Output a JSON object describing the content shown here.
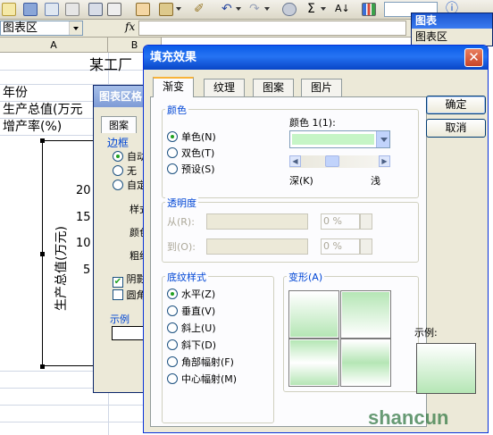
{
  "formula_bar": {
    "name_box": "图表区",
    "fx": "fx"
  },
  "columns": [
    "A",
    "B"
  ],
  "sheet": {
    "title_cell": "某工厂",
    "rows": [
      "年份",
      "生产总值(万元",
      "增产率(%)"
    ]
  },
  "chart": {
    "ylabel": "生产总值(万元)",
    "ticks": [
      "20",
      "15",
      "10",
      "5"
    ]
  },
  "chart_popup": {
    "title": "图表",
    "item": "图表区"
  },
  "back_dialog": {
    "title": "图表区格",
    "tab": "图案",
    "border_label": "边框",
    "border_options": [
      "自动",
      "无",
      "自定"
    ],
    "style_label": "样式",
    "color_label": "颜色",
    "weight_label": "粗细",
    "shadow_label": "阴影",
    "round_label": "圆角",
    "sample_label": "示例"
  },
  "dialog": {
    "title": "填充效果",
    "tabs": [
      "渐变",
      "纹理",
      "图案",
      "图片"
    ],
    "color_group": "颜色",
    "color_options": [
      "单色(N)",
      "双色(T)",
      "预设(S)"
    ],
    "color1_label": "颜色 1(1):",
    "color1_value": "#c6f5c6",
    "dark_label": "深(K)",
    "light_label": "浅",
    "transparency_group": "透明度",
    "from_label": "从(R):",
    "to_label": "到(O):",
    "from_value": "0 %",
    "to_value": "0 %",
    "shading_group": "底纹样式",
    "shading_options": [
      "水平(Z)",
      "垂直(V)",
      "斜上(U)",
      "斜下(D)",
      "角部幅射(F)",
      "中心幅射(M)"
    ],
    "variants_group": "变形(A)",
    "sample_label": "示例:",
    "ok_button": "确定",
    "cancel_button": "取消"
  },
  "watermark": "shancun",
  "colors": {
    "titlebar": "#0a5ce7",
    "gradient_color": "#b5e6b5",
    "accent": "#0046d5"
  }
}
